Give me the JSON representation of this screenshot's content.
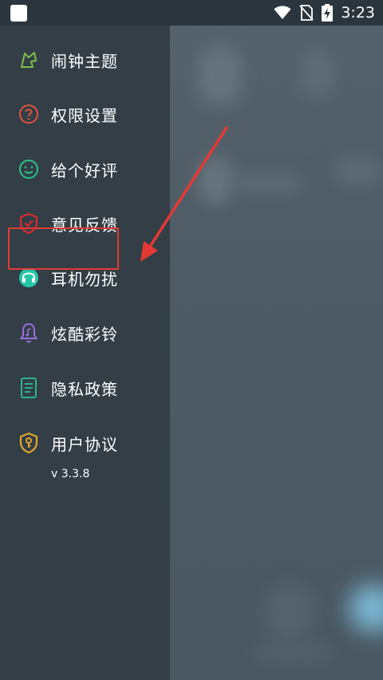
{
  "status_bar": {
    "time": "3:23",
    "icons": [
      "app-icon",
      "wifi-icon",
      "no-sim-icon",
      "battery-charging-icon"
    ]
  },
  "drawer": {
    "items": [
      {
        "label": "闹钟主题",
        "icon": "theme-icon",
        "color": "#7cc04b"
      },
      {
        "label": "权限设置",
        "icon": "question-icon",
        "color": "#e0523e"
      },
      {
        "label": "给个好评",
        "icon": "smile-icon",
        "color": "#2bc48a"
      },
      {
        "label": "意见反馈",
        "icon": "shield-check-icon",
        "color": "#d92b2b"
      },
      {
        "label": "耳机勿扰",
        "icon": "headphones-icon",
        "color": "#26c6a8"
      },
      {
        "label": "炫酷彩铃",
        "icon": "bell-music-icon",
        "color": "#9b6ee0"
      },
      {
        "label": "隐私政策",
        "icon": "document-icon",
        "color": "#2bb58a"
      },
      {
        "label": "用户协议",
        "icon": "shield-key-icon",
        "color": "#e0a52b"
      }
    ],
    "version": "v 3.3.8"
  },
  "annotation": {
    "highlight_color": "#e53935"
  }
}
